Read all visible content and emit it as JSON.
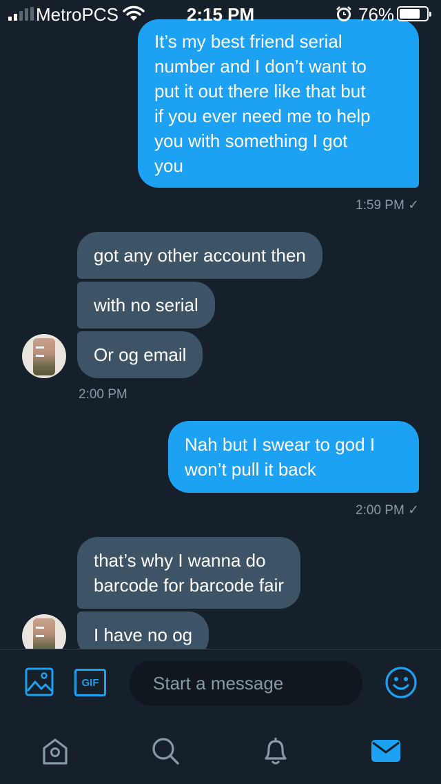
{
  "status_bar": {
    "carrier": "MetroPCS",
    "time": "2:15 PM",
    "battery_percent": "76%",
    "battery_level": 0.76,
    "signal_bars": 2,
    "icons": [
      "signal-icon",
      "wifi-icon",
      "alarm-icon",
      "battery-icon"
    ]
  },
  "messages": [
    {
      "direction": "outgoing",
      "lines": [
        "It’s my best friend serial",
        "number and I don’t want to",
        "put it out there like that but",
        "if you ever need me to help",
        "you with something I got",
        "you"
      ]
    },
    {
      "direction": "outgoing",
      "timestamp": "1:59 PM ✓"
    },
    {
      "direction": "incoming",
      "text": "got any other account then"
    },
    {
      "direction": "incoming",
      "text": "with no serial"
    },
    {
      "direction": "incoming",
      "text": "Or og email"
    },
    {
      "direction": "incoming",
      "timestamp": "2:00 PM"
    },
    {
      "direction": "outgoing",
      "lines": [
        "Nah but I swear to god I",
        "won’t pull it back"
      ]
    },
    {
      "direction": "outgoing",
      "timestamp": "2:00 PM ✓"
    },
    {
      "direction": "incoming",
      "lines": [
        "that’s why I wanna do",
        "barcode for barcode fair"
      ]
    },
    {
      "direction": "incoming",
      "text": "I have no og"
    }
  ],
  "composer": {
    "placeholder": "Start a message",
    "gif_label": "GIF",
    "icons": [
      "image-icon",
      "gif-icon",
      "emoji-icon"
    ]
  },
  "tab_bar": {
    "tabs": [
      "home",
      "search",
      "notifications",
      "messages"
    ],
    "active": "messages"
  },
  "colors": {
    "background": "#15202b",
    "accent": "#1da1f2",
    "incoming_bubble": "#3d5466",
    "muted_text": "#8899a6",
    "input_background": "#10171e"
  }
}
